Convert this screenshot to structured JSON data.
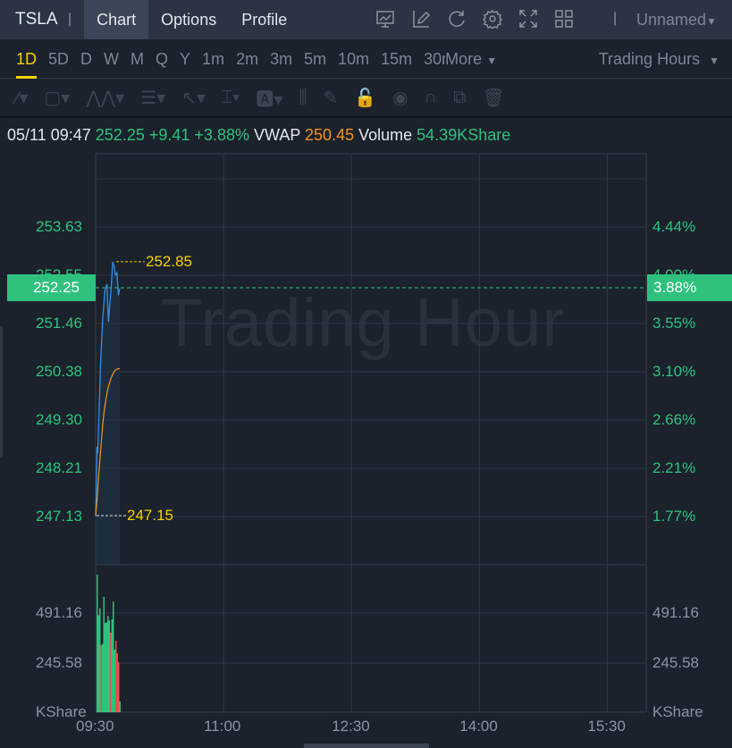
{
  "header": {
    "symbol": "TSLA",
    "tabs": [
      "Chart",
      "Options",
      "Profile"
    ],
    "layout_name": "Unnamed"
  },
  "periods": [
    "1D",
    "5D",
    "D",
    "W",
    "M",
    "Q",
    "Y",
    "1m",
    "2m",
    "3m",
    "5m",
    "10m",
    "15m",
    "30m",
    "More"
  ],
  "session": "Trading Hours",
  "info": {
    "datetime": "05/11 09:47",
    "price": "252.25",
    "change": "+9.41",
    "change_pct": "+3.88%",
    "vwap_label": "VWAP",
    "vwap": "250.45",
    "volume_label": "Volume",
    "volume": "54.39KShare"
  },
  "watermark": "Trading Hour",
  "colors": {
    "up": "#2ec27e",
    "down": "#e5534b",
    "price_line": "#2f8fe8",
    "vwap_line": "#f39422",
    "high_low": "#f5d000"
  },
  "chart_data": {
    "type": "line",
    "price_ticks": [
      "253.63",
      "252.55",
      "251.46",
      "250.38",
      "249.30",
      "248.21",
      "247.13"
    ],
    "pct_ticks": [
      "4.44%",
      "4.00%",
      "3.55%",
      "3.10%",
      "2.66%",
      "2.21%",
      "1.77%"
    ],
    "current_price": "252.25",
    "current_pct": "3.88%",
    "high_label": "252.85",
    "low_label": "247.15",
    "ylim": [
      247.13,
      253.63
    ],
    "x_ticks": [
      "09:30",
      "11:00",
      "12:30",
      "14:00",
      "15:30"
    ],
    "x_minutes": [
      0,
      90,
      180,
      270,
      360
    ],
    "price": [
      [
        0,
        247.13
      ],
      [
        1,
        248.7
      ],
      [
        1.5,
        248.55
      ],
      [
        2.5,
        249.6
      ],
      [
        3.5,
        250.6
      ],
      [
        5,
        251.6
      ],
      [
        6.5,
        252.2
      ],
      [
        8,
        252.35
      ],
      [
        9,
        251.5
      ],
      [
        10,
        251.9
      ],
      [
        11,
        252.3
      ],
      [
        12,
        252.85
      ],
      [
        13,
        252.75
      ],
      [
        14,
        252.55
      ],
      [
        15,
        252.6
      ],
      [
        16,
        252.1
      ],
      [
        17,
        252.25
      ]
    ],
    "vwap": [
      [
        0,
        247.15
      ],
      [
        1,
        247.5
      ],
      [
        2,
        248.0
      ],
      [
        3,
        248.4
      ],
      [
        4,
        248.8
      ],
      [
        5,
        249.2
      ],
      [
        6,
        249.5
      ],
      [
        7,
        249.7
      ],
      [
        8,
        249.9
      ],
      [
        9,
        250.05
      ],
      [
        10,
        250.15
      ],
      [
        11,
        250.25
      ],
      [
        12,
        250.32
      ],
      [
        13,
        250.38
      ],
      [
        14,
        250.42
      ],
      [
        15,
        250.44
      ],
      [
        16,
        250.45
      ],
      [
        17,
        250.45
      ]
    ],
    "volume_ticks": [
      "491.16",
      "245.58"
    ],
    "volume_unit": "KShare",
    "volume_max": 982.32,
    "volume": [
      [
        675,
        "up"
      ],
      [
        476,
        "up"
      ],
      [
        510,
        "up"
      ],
      [
        329,
        "down"
      ],
      [
        335,
        "up"
      ],
      [
        566,
        "up"
      ],
      [
        438,
        "up"
      ],
      [
        440,
        "up"
      ],
      [
        473,
        "up"
      ],
      [
        450,
        "up"
      ],
      [
        390,
        "down"
      ],
      [
        455,
        "up"
      ],
      [
        543,
        "up"
      ],
      [
        307,
        "up"
      ],
      [
        350,
        "down"
      ],
      [
        289,
        "down"
      ],
      [
        245,
        "down"
      ],
      [
        53,
        "up"
      ]
    ]
  }
}
